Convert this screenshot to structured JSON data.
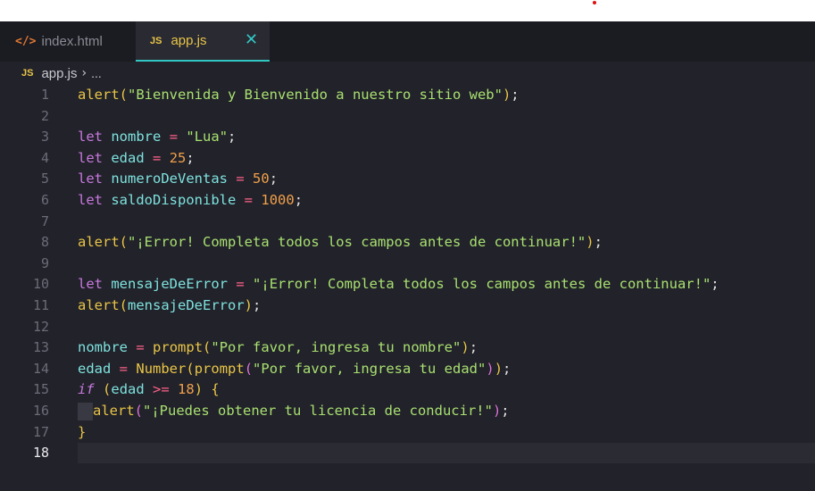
{
  "tabs": [
    {
      "icon": "html-code-icon",
      "glyph": "</>",
      "label": "index.html",
      "active": false
    },
    {
      "icon": "js-file-icon",
      "glyph": "JS",
      "label": "app.js",
      "active": true,
      "close_glyph": "✕"
    }
  ],
  "breadcrumb": {
    "icon_glyph": "JS",
    "file": "app.js",
    "separator": "›",
    "rest": "..."
  },
  "editor": {
    "active_line": 18,
    "line_numbers": [
      "1",
      "2",
      "3",
      "4",
      "5",
      "6",
      "7",
      "8",
      "9",
      "10",
      "11",
      "12",
      "13",
      "14",
      "15",
      "16",
      "17",
      "18"
    ],
    "lines": [
      [
        {
          "t": "fn",
          "v": "alert"
        },
        {
          "t": "p1",
          "v": "("
        },
        {
          "t": "str",
          "v": "\"Bienvenida y Bienvenido a nuestro sitio web\""
        },
        {
          "t": "p1",
          "v": ")"
        },
        {
          "t": "plain",
          "v": ";"
        }
      ],
      [],
      [
        {
          "t": "kw",
          "v": "let"
        },
        {
          "t": "plain",
          "v": " "
        },
        {
          "t": "var",
          "v": "nombre"
        },
        {
          "t": "plain",
          "v": " "
        },
        {
          "t": "op",
          "v": "="
        },
        {
          "t": "plain",
          "v": " "
        },
        {
          "t": "str",
          "v": "\"Lua\""
        },
        {
          "t": "plain",
          "v": ";"
        }
      ],
      [
        {
          "t": "kw",
          "v": "let"
        },
        {
          "t": "plain",
          "v": " "
        },
        {
          "t": "var",
          "v": "edad"
        },
        {
          "t": "plain",
          "v": " "
        },
        {
          "t": "op",
          "v": "="
        },
        {
          "t": "plain",
          "v": " "
        },
        {
          "t": "num",
          "v": "25"
        },
        {
          "t": "plain",
          "v": ";"
        }
      ],
      [
        {
          "t": "kw",
          "v": "let"
        },
        {
          "t": "plain",
          "v": " "
        },
        {
          "t": "var",
          "v": "numeroDeVentas"
        },
        {
          "t": "plain",
          "v": " "
        },
        {
          "t": "op",
          "v": "="
        },
        {
          "t": "plain",
          "v": " "
        },
        {
          "t": "num",
          "v": "50"
        },
        {
          "t": "plain",
          "v": ";"
        }
      ],
      [
        {
          "t": "kw",
          "v": "let"
        },
        {
          "t": "plain",
          "v": " "
        },
        {
          "t": "var",
          "v": "saldoDisponible"
        },
        {
          "t": "plain",
          "v": " "
        },
        {
          "t": "op",
          "v": "="
        },
        {
          "t": "plain",
          "v": " "
        },
        {
          "t": "num",
          "v": "1000"
        },
        {
          "t": "plain",
          "v": ";"
        }
      ],
      [],
      [
        {
          "t": "fn",
          "v": "alert"
        },
        {
          "t": "p1",
          "v": "("
        },
        {
          "t": "str",
          "v": "\"¡Error! Completa todos los campos antes de continuar!\""
        },
        {
          "t": "p1",
          "v": ")"
        },
        {
          "t": "plain",
          "v": ";"
        }
      ],
      [],
      [
        {
          "t": "kw",
          "v": "let"
        },
        {
          "t": "plain",
          "v": " "
        },
        {
          "t": "var",
          "v": "mensajeDeError"
        },
        {
          "t": "plain",
          "v": " "
        },
        {
          "t": "op",
          "v": "="
        },
        {
          "t": "plain",
          "v": " "
        },
        {
          "t": "str",
          "v": "\"¡Error! Completa todos los campos antes de continuar!\""
        },
        {
          "t": "plain",
          "v": ";"
        }
      ],
      [
        {
          "t": "fn",
          "v": "alert"
        },
        {
          "t": "p1",
          "v": "("
        },
        {
          "t": "var",
          "v": "mensajeDeError"
        },
        {
          "t": "p1",
          "v": ")"
        },
        {
          "t": "plain",
          "v": ";"
        }
      ],
      [],
      [
        {
          "t": "var",
          "v": "nombre"
        },
        {
          "t": "plain",
          "v": " "
        },
        {
          "t": "op",
          "v": "="
        },
        {
          "t": "plain",
          "v": " "
        },
        {
          "t": "fn",
          "v": "prompt"
        },
        {
          "t": "p1",
          "v": "("
        },
        {
          "t": "str",
          "v": "\"Por favor, ingresa tu nombre\""
        },
        {
          "t": "p1",
          "v": ")"
        },
        {
          "t": "plain",
          "v": ";"
        }
      ],
      [
        {
          "t": "var",
          "v": "edad"
        },
        {
          "t": "plain",
          "v": " "
        },
        {
          "t": "op",
          "v": "="
        },
        {
          "t": "plain",
          "v": " "
        },
        {
          "t": "fn",
          "v": "Number"
        },
        {
          "t": "p1",
          "v": "("
        },
        {
          "t": "fn",
          "v": "prompt"
        },
        {
          "t": "p2",
          "v": "("
        },
        {
          "t": "str",
          "v": "\"Por favor, ingresa tu edad\""
        },
        {
          "t": "p2",
          "v": ")"
        },
        {
          "t": "p1",
          "v": ")"
        },
        {
          "t": "plain",
          "v": ";"
        }
      ],
      [
        {
          "t": "kwi",
          "v": "if"
        },
        {
          "t": "plain",
          "v": " "
        },
        {
          "t": "p1",
          "v": "("
        },
        {
          "t": "var",
          "v": "edad"
        },
        {
          "t": "plain",
          "v": " "
        },
        {
          "t": "op",
          "v": ">="
        },
        {
          "t": "plain",
          "v": " "
        },
        {
          "t": "num",
          "v": "18"
        },
        {
          "t": "p1",
          "v": ")"
        },
        {
          "t": "plain",
          "v": " "
        },
        {
          "t": "p1",
          "v": "{"
        }
      ],
      [
        {
          "t": "indent",
          "v": ""
        },
        {
          "t": "fn",
          "v": "alert"
        },
        {
          "t": "p2",
          "v": "("
        },
        {
          "t": "str",
          "v": "\"¡Puedes obtener tu licencia de conducir!\""
        },
        {
          "t": "p2",
          "v": ")"
        },
        {
          "t": "plain",
          "v": ";"
        }
      ],
      [
        {
          "t": "p1",
          "v": "}"
        }
      ],
      []
    ]
  }
}
